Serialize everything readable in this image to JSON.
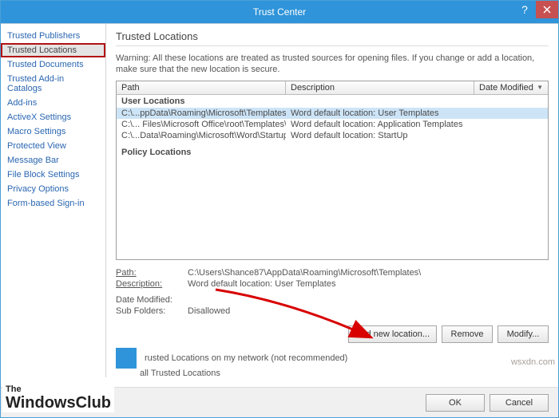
{
  "window": {
    "title": "Trust Center"
  },
  "sidebar": {
    "items": [
      "Trusted Publishers",
      "Trusted Locations",
      "Trusted Documents",
      "Trusted Add-in Catalogs",
      "Add-ins",
      "ActiveX Settings",
      "Macro Settings",
      "Protected View",
      "Message Bar",
      "File Block Settings",
      "Privacy Options",
      "Form-based Sign-in"
    ],
    "active_index": 1
  },
  "main": {
    "heading": "Trusted Locations",
    "warning": "Warning: All these locations are treated as trusted sources for opening files. If you change or add a location, make sure that the new location is secure.",
    "columns": {
      "path": "Path",
      "desc": "Description",
      "date": "Date Modified"
    },
    "groups": {
      "user": "User Locations",
      "policy": "Policy Locations"
    },
    "rows": [
      {
        "path": "C:\\...ppData\\Roaming\\Microsoft\\Templates\\",
        "desc": "Word default location: User Templates",
        "selected": true
      },
      {
        "path": "C:\\... Files\\Microsoft Office\\root\\Templates\\",
        "desc": "Word default location: Application Templates",
        "selected": false
      },
      {
        "path": "C:\\...Data\\Roaming\\Microsoft\\Word\\Startup\\",
        "desc": "Word default location: StartUp",
        "selected": false
      }
    ],
    "details": {
      "path_label": "Path:",
      "path_value": "C:\\Users\\Shance87\\AppData\\Roaming\\Microsoft\\Templates\\",
      "desc_label": "Description:",
      "desc_value": "Word default location: User Templates",
      "date_label": "Date Modified:",
      "date_value": "",
      "sub_label": "Sub Folders:",
      "sub_value": "Disallowed"
    },
    "buttons": {
      "add": "Add new location...",
      "remove": "Remove",
      "modify": "Modify..."
    },
    "checks": {
      "network": "rusted Locations on my network (not recommended)",
      "disable": "all Trusted Locations"
    }
  },
  "footer": {
    "ok": "OK",
    "cancel": "Cancel"
  },
  "overlay": {
    "logo1": "The",
    "logo2": "WindowsClub",
    "watermark": "wsxdn.com"
  }
}
